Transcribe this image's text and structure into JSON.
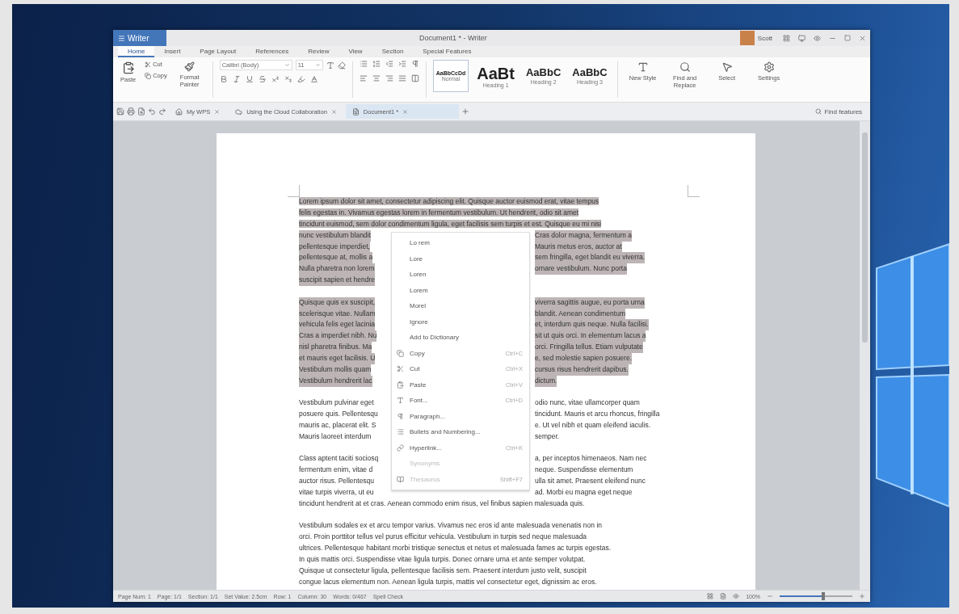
{
  "app_button": "Writer",
  "window_title": "Document1 * - Writer",
  "account": "Scott",
  "menu_tabs": [
    {
      "label": "Home",
      "selected": true
    },
    {
      "label": "Insert",
      "selected": false
    },
    {
      "label": "Page Layout",
      "selected": false
    },
    {
      "label": "References",
      "selected": false
    },
    {
      "label": "Review",
      "selected": false
    },
    {
      "label": "View",
      "selected": false
    },
    {
      "label": "Section",
      "selected": false
    },
    {
      "label": "Special Features",
      "selected": false
    }
  ],
  "ribbon": {
    "paste": "Paste",
    "cut": "Cut",
    "copy": "Copy",
    "format_painter": "Format Painter",
    "font_name": "Calibri (Body)",
    "font_size": "11",
    "styles": [
      {
        "sample": "AaBbCcDd",
        "label": "Normal",
        "selected": true,
        "kind": "small"
      },
      {
        "sample": "AaBt",
        "label": "Heading 1",
        "selected": false,
        "kind": "large"
      },
      {
        "sample": "AaBbC",
        "label": "Heading 2",
        "selected": false,
        "kind": "medium"
      },
      {
        "sample": "AaBbC",
        "label": "Heading 3",
        "selected": false,
        "kind": "medium"
      }
    ],
    "tools": [
      {
        "label": "New Style",
        "kind": "style"
      },
      {
        "label": "Find and Replace",
        "kind": "find"
      },
      {
        "label": "Select",
        "kind": "select"
      },
      {
        "label": "Settings",
        "kind": "settings"
      }
    ]
  },
  "doc_tabs": [
    {
      "label": "My WPS",
      "selected": false,
      "kind": "home"
    },
    {
      "label": "Using the Cloud Collaboration",
      "selected": false,
      "kind": "cloud"
    },
    {
      "label": "Document1 *",
      "selected": true,
      "kind": "doc"
    }
  ],
  "find_features": "Find features",
  "paragraphs": [
    {
      "selected": true,
      "lines": [
        {
          "text": "Lorem ipsum dolor sit amet, consectetur adipiscing elit. Quisque auctor euismod erat, vitae tempus"
        },
        {
          "text": "felis egestas in. Vivamus egestas lorem in fermentum vestibulum. Ut hendrerit, odio sit amet"
        },
        {
          "text": "tincidunt euismod, sem dolor condimentum ligula, eget facilisis sem turpis et est. Quisque eu mi nisi"
        },
        {
          "left": "nunc vestibulum blandit",
          "right": "Cras dolor magna, fermentum a"
        },
        {
          "left": "pellentesque imperdiet,",
          "right": "Mauris metus eros, auctor at"
        },
        {
          "left": "pellentesque at, mollis a",
          "right": "sem fringilla, eget blandit eu viverra."
        },
        {
          "left": "Nulla pharetra non lorem",
          "right": "ornare vestibulum. Nunc porta"
        },
        {
          "left": "suscipit sapien et hendre"
        }
      ]
    },
    {
      "selected": true,
      "lines": [
        {
          "left": "Quisque quis ex suscipit,",
          "right": "viverra sagittis augue, eu porta urna"
        },
        {
          "left": "scelerisque vitae. Nullam",
          "right": "blandit. Aenean condimentum"
        },
        {
          "left": "vehicula felis eget lacinia",
          "right": "et, interdum quis neque. Nulla facilisi."
        },
        {
          "left": "Cras a imperdiet nibh. Nu",
          "right": "sit ut quis orci. In elementum lacus a"
        },
        {
          "left": "nisl pharetra finibus. Ma",
          "right": "orci. Fringilla tellus. Etiam vulputate"
        },
        {
          "left": "et mauris eget facilisis. U",
          "right": "e, sed molestie sapien posuere."
        },
        {
          "left": "Vestibulum mollis quam",
          "right": "cursus risus hendrerit dapibus."
        },
        {
          "left": "Vestibulum hendrerit lac",
          "right": "dictum."
        }
      ]
    },
    {
      "selected": false,
      "lines": [
        {
          "left": "Vestibulum pulvinar eget",
          "right": "odio nunc, vitae ullamcorper quam"
        },
        {
          "left": "posuere quis. Pellentesqu",
          "right": "tincidunt. Mauris et arcu rhoncus, fringilla"
        },
        {
          "left": "mauris ac, placerat elit. S",
          "right": "e. Ut vel nibh et quam eleifend iaculis."
        },
        {
          "left": "Mauris laoreet interdum",
          "right": "semper."
        }
      ]
    },
    {
      "selected": false,
      "lines": [
        {
          "left": "Class aptent taciti sociosq",
          "right": "a, per inceptos himenaeos. Nam nec"
        },
        {
          "left": "fermentum enim, vitae d",
          "right": "neque. Suspendisse elementum"
        },
        {
          "left": "auctor risus. Pellentesqu",
          "right": "ulla sit amet. Praesent eleifend nunc"
        },
        {
          "left": "vitae turpis viverra, ut eu",
          "right": "ad. Morbi eu magna eget neque"
        },
        {
          "text": "tincidunt hendrerit at et cras. Aenean commodo enim risus, vel finibus sapien malesuada quis."
        }
      ]
    },
    {
      "selected": false,
      "lines": [
        {
          "text": "Vestibulum sodales ex et arcu tempor varius. Vivamus nec eros id ante malesuada venenatis non in"
        },
        {
          "text": "orci. Proin porttitor tellus vel purus efficitur vehicula. Vestibulum in turpis sed neque malesuada"
        },
        {
          "text": "ultrices. Pellentesque habitant morbi tristique senectus et netus et malesuada fames ac turpis egestas."
        },
        {
          "text": "In quis mattis orci. Suspendisse vitae ligula turpis. Donec ornare urna et ante semper volutpat."
        },
        {
          "text": "Quisque ut consectetur ligula, pellentesque facilisis sem. Praesent interdum justo velit, suscipit"
        },
        {
          "text": "congue lacus elementum non. Aenean ligula turpis, mattis vel consectetur eget, dignissim ac eros."
        }
      ]
    }
  ],
  "context_menu": [
    {
      "label": "Lo rem",
      "kind": "suggestion",
      "disabled": false
    },
    {
      "label": "Lore",
      "kind": "suggestion",
      "disabled": false
    },
    {
      "label": "Loren",
      "kind": "suggestion",
      "disabled": false
    },
    {
      "label": "Lorem",
      "kind": "suggestion",
      "disabled": false
    },
    {
      "label": "Morel",
      "kind": "suggestion",
      "disabled": false
    },
    {
      "label": "Ignore",
      "kind": "suggestion",
      "disabled": false
    },
    {
      "label": "Add to Dictionary",
      "kind": "suggestion",
      "disabled": false
    },
    {
      "label": "Copy",
      "shortcut": "Ctrl+C",
      "kind": "copy",
      "disabled": false
    },
    {
      "label": "Cut",
      "shortcut": "Ctrl+X",
      "kind": "cut",
      "disabled": false
    },
    {
      "label": "Paste",
      "shortcut": "Ctrl+V",
      "kind": "paste",
      "disabled": false
    },
    {
      "label": "Font...",
      "shortcut": "Ctrl+D",
      "kind": "font",
      "disabled": false
    },
    {
      "label": "Paragraph...",
      "kind": "paragraph",
      "disabled": false
    },
    {
      "label": "Bullets and Numbering...",
      "kind": "list",
      "disabled": false
    },
    {
      "label": "Hyperlink...",
      "shortcut": "Ctrl+K",
      "kind": "link",
      "disabled": false
    },
    {
      "label": "Synonyms",
      "kind": "suggestion",
      "disabled": true
    },
    {
      "label": "Thesaurus",
      "shortcut": "Shift+F7",
      "kind": "book",
      "disabled": true
    }
  ],
  "status_bar": [
    "Page Num: 1",
    "Page: 1/1",
    "Section: 1/1",
    "Set Value: 2.5cm",
    "Row: 1",
    "Column: 30",
    "Words: 0/467",
    "Spell Check"
  ],
  "zoom": "100%",
  "zoom_slider": {
    "level": 0.6
  }
}
